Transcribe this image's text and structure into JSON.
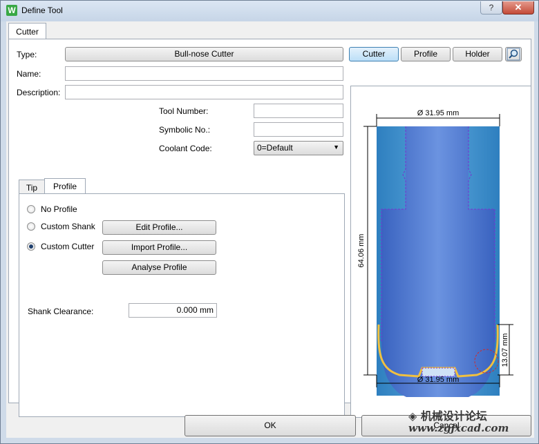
{
  "window": {
    "title": "Define Tool",
    "app_icon_letter": "W",
    "help_glyph": "?",
    "close_glyph": "✕"
  },
  "main_tab": {
    "label": "Cutter"
  },
  "form": {
    "type_label": "Type:",
    "type_value": "Bull-nose Cutter",
    "name_label": "Name:",
    "name_value": "",
    "description_label": "Description:",
    "description_value": "",
    "tool_number_label": "Tool Number:",
    "tool_number_value": "",
    "symbolic_no_label": "Symbolic No.:",
    "symbolic_no_value": "",
    "coolant_code_label": "Coolant Code:",
    "coolant_code_value": "0=Default"
  },
  "view_buttons": {
    "cutter": "Cutter",
    "profile": "Profile",
    "holder": "Holder",
    "zoom_icon": "magnifier-icon"
  },
  "subtabs": {
    "tip": "Tip",
    "profile": "Profile"
  },
  "profile_panel": {
    "no_profile": "No Profile",
    "custom_shank": "Custom Shank",
    "custom_cutter": "Custom Cutter",
    "edit_profile": "Edit Profile...",
    "import_profile": "Import Profile...",
    "analyse_profile": "Analyse Profile",
    "shank_clearance_label": "Shank Clearance:",
    "shank_clearance_value": "0.000 mm",
    "selected": "custom_cutter"
  },
  "preview": {
    "top_diameter": "Ø 31.95 mm",
    "height": "64.06 mm",
    "bottom_diameter": "Ø 31.95 mm",
    "corner_height": "13.07 mm",
    "body_color": "#3f6fcf",
    "edge_color": "#f0c040"
  },
  "footer": {
    "ok": "OK",
    "cancel": "Cancel"
  },
  "watermark": {
    "text": "机械设计论坛",
    "site": "www.zgjxcad.com"
  }
}
